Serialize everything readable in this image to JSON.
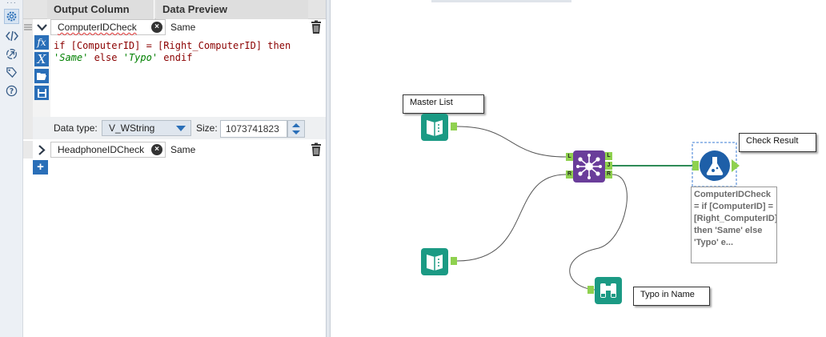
{
  "config_panel": {
    "headers": {
      "output_column": "Output Column",
      "data_preview": "Data Preview"
    },
    "rows": [
      {
        "name": "ComputerIDCheck",
        "preview": "Same",
        "expanded": true
      },
      {
        "name": "HeadphoneIDCheck",
        "preview": "Same",
        "expanded": false
      }
    ],
    "expression": {
      "line1": "if [ComputerID] = [Right_ComputerID] then",
      "str1": "'Same'",
      "mid": " else ",
      "str2": "'Typo'",
      "end": " endif"
    },
    "data_type_label": "Data type:",
    "data_type_value": "V_WString",
    "size_label": "Size:",
    "size_value": "1073741823",
    "add_label": "+"
  },
  "canvas": {
    "annotations": {
      "master_list": "Master List",
      "check_result": "Check Result",
      "typo_in_name": "Typo in Name"
    },
    "formula_annotation": "ComputerIDCheck = if [ComputerID] = [Right_ComputerID] then 'Same' else 'Typo' e...",
    "join_ports": {
      "left": "L",
      "right": "R",
      "out_left": "L",
      "out_join": "J",
      "out_right": "R"
    }
  },
  "icons": {
    "rail": [
      "gear-icon",
      "code-icon",
      "navigate-icon",
      "tag-icon",
      "help-icon"
    ],
    "editor": [
      "function-icon",
      "variable-icon",
      "open-folder-icon",
      "save-icon"
    ]
  },
  "colors": {
    "accent_blue": "#2a6fb8",
    "input_tool_green": "#1b9a84",
    "join_purple": "#6a3d9a",
    "formula_blue": "#1e5fa8",
    "connection_green": "#2e8b57",
    "port_green": "#8fd14f"
  }
}
